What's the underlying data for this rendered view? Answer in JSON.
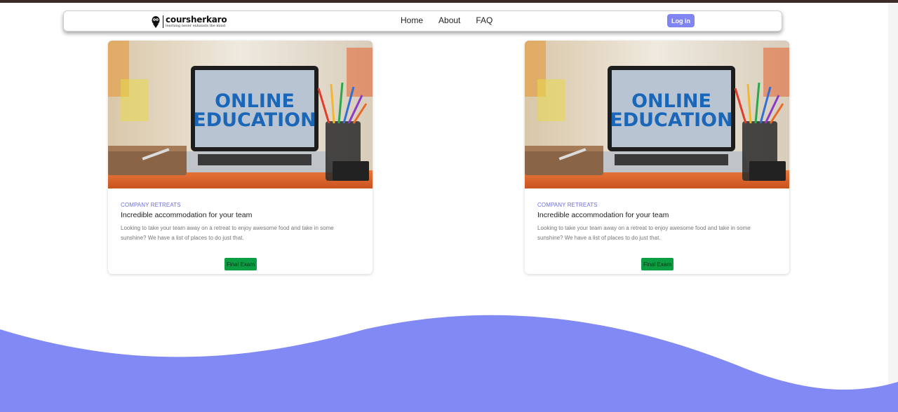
{
  "colors": {
    "accent": "#7f86f3",
    "wave": "#8189f4",
    "button_green": "#0d9e44",
    "top_bar": "#3b2a26"
  },
  "nav": {
    "logo": {
      "name": "coursherkaro",
      "tagline": "learning never exhausts the mind",
      "icon": "owl-head-icon"
    },
    "links": [
      "Home",
      "About",
      "FAQ"
    ],
    "login_label": "Log in"
  },
  "cards": [
    {
      "image_text": [
        "ONLINE",
        "EDUCATION"
      ],
      "eyebrow": "COMPANY RETREATS",
      "title": "Incredible accommodation for your team",
      "description": "Looking to take your team away on a retreat to enjoy awesome food and take in some sunshine? We have a list of places to do just that.",
      "button_label": "Final Exam"
    },
    {
      "image_text": [
        "ONLINE",
        "EDUCATION"
      ],
      "eyebrow": "COMPANY RETREATS",
      "title": "Incredible accommodation for your team",
      "description": "Looking to take your team away on a retreat to enjoy awesome food and take in some sunshine? We have a list of places to do just that.",
      "button_label": "Final Exam"
    }
  ]
}
